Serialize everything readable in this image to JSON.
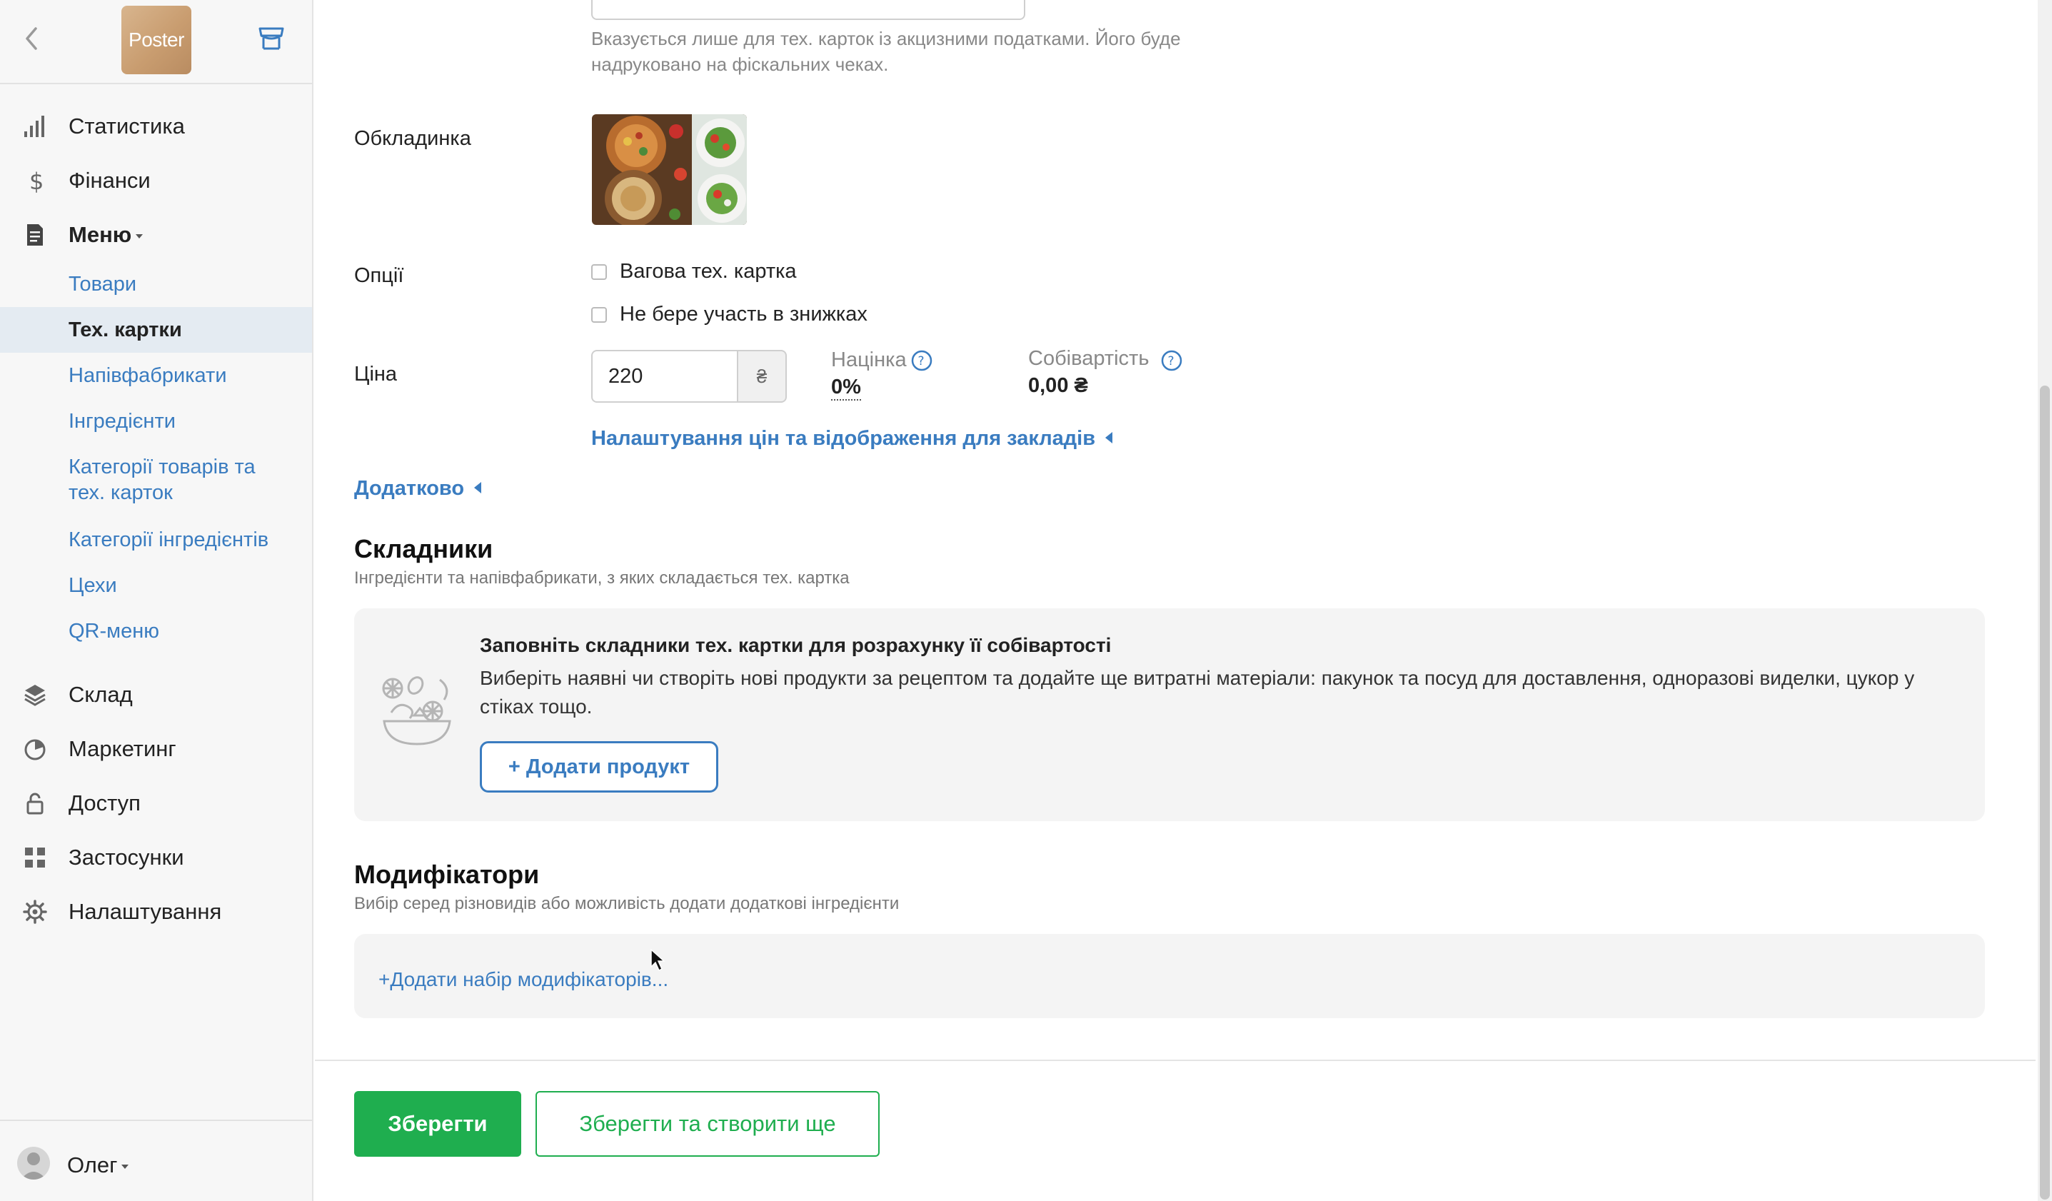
{
  "sidebar": {
    "logo_text": "Poster",
    "nav": [
      {
        "label": "Статистика",
        "icon": "bar-chart-icon"
      },
      {
        "label": "Фінанси",
        "icon": "dollar-icon"
      },
      {
        "label": "Меню",
        "icon": "document-icon"
      },
      {
        "label": "Склад",
        "icon": "layers-icon"
      },
      {
        "label": "Маркетинг",
        "icon": "pie-icon"
      },
      {
        "label": "Доступ",
        "icon": "lock-icon"
      },
      {
        "label": "Застосунки",
        "icon": "grid-icon"
      },
      {
        "label": "Налаштування",
        "icon": "gear-icon"
      }
    ],
    "menu_sub": [
      {
        "label": "Товари"
      },
      {
        "label": "Тех. картки",
        "active": true
      },
      {
        "label": "Напівфабрикати"
      },
      {
        "label": "Інгредієнти"
      },
      {
        "label": "Категорії товарів та тех. карток"
      },
      {
        "label": "Категорії інгредієнтів"
      },
      {
        "label": "Цехи"
      },
      {
        "label": "QR-меню"
      }
    ],
    "user_name": "Олег"
  },
  "form": {
    "excise_hint": "Вказується лише для тех. карток із акцизними податками. Його буде надруковано на фіскальних чеках.",
    "cover_label": "Обкладинка",
    "options_label": "Опції",
    "options": [
      {
        "label": "Вагова тех. картка",
        "checked": false
      },
      {
        "label": "Не бере участь в знижках",
        "checked": false
      }
    ],
    "price_label": "Ціна",
    "price_value": "220",
    "currency": "₴",
    "markup_label": "Націнка",
    "markup_value": "0%",
    "cost_label": "Собівартість",
    "cost_value": "0,00 ₴",
    "price_settings_link": "Налаштування цін та відображення для закладів",
    "additional_link": "Додатково"
  },
  "ingredients": {
    "title": "Складники",
    "subtitle": "Інгредієнти та напівфабрикати, з яких складається тех. картка",
    "box_title": "Заповніть складники тех. картки для розрахунку її собівартості",
    "box_desc": "Виберіть наявні чи створіть нові продукти за рецептом та додайте ще витратні матеріали: пакунок та посуд для доставлення, одноразові виделки, цукор у стіках тощо.",
    "add_button": "+ Додати продукт"
  },
  "modifiers": {
    "title": "Модифікатори",
    "subtitle": "Вибір серед різновидів або можливість додати додаткові інгредієнти",
    "add_link": "+Додати набір модифікаторів..."
  },
  "footer": {
    "save": "Зберегти",
    "save_and_create": "Зберегти та створити ще"
  },
  "colors": {
    "accent_blue": "#3a7cc0",
    "save_green": "#1fae4f",
    "active_item_bg": "#e4ebf2"
  }
}
